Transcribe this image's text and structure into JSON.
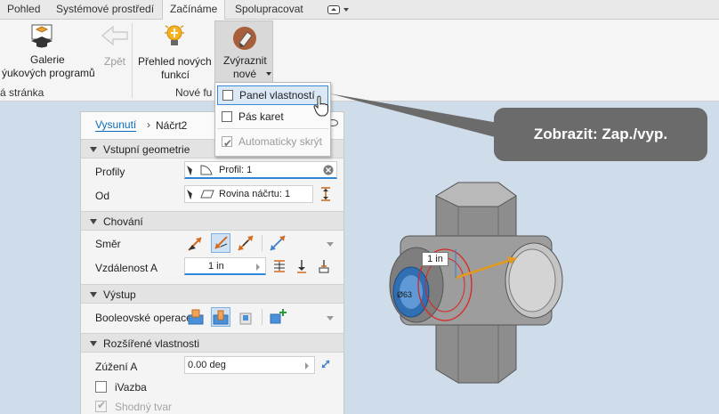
{
  "tabs": [
    "Pohled",
    "Systémové prostředí",
    "Začínáme",
    "Spolupracovat"
  ],
  "ribbon": {
    "gallery_label_1": "Galerie",
    "gallery_label_2": "ýukových programů",
    "back_label": "Zpět",
    "new_features_label_1": "Přehled nových",
    "new_features_label_2": "funkcí",
    "highlight_label_1": "Zvýraznit",
    "highlight_label_2": "nové",
    "panel_left": "á stránka",
    "panel_new": "Nové fu"
  },
  "dropdown": {
    "items": [
      {
        "label": "Panel vlastností",
        "checked": false,
        "hover": true
      },
      {
        "label": "Pás karet",
        "checked": false
      },
      {
        "label": "Automaticky skrýt",
        "checked": true,
        "disabled": true
      }
    ]
  },
  "callout": {
    "text": "Zobrazit: Zap./vyp."
  },
  "panel": {
    "breadcrumb_link": "Vysunutí",
    "breadcrumb_sep": "›",
    "breadcrumb_current": "Náčrt2",
    "sections": {
      "input": "Vstupní geometrie",
      "behavior": "Chování",
      "output": "Výstup",
      "advanced": "Rozšířené vlastnosti"
    },
    "profiles_label": "Profily",
    "profiles_value": "Profil: 1",
    "from_label": "Od",
    "from_value": "Rovina náčrtu: 1",
    "direction_label": "Směr",
    "distance_label": "Vzdálenost A",
    "distance_value": "1 in",
    "boolean_label": "Booleovské operace",
    "taper_label": "Zúžení A",
    "taper_value": "0.00 deg",
    "ivazba_label": "iVazba",
    "match_shape_label": "Shodný tvar"
  },
  "viewport": {
    "dimension_label": "1 in",
    "part_label": "Ø63"
  },
  "colors": {
    "accent": "#2e86d6",
    "link": "#0b6cbf",
    "callout_bg": "#6b6b6b",
    "viewport_bg": "#cfdce9"
  }
}
